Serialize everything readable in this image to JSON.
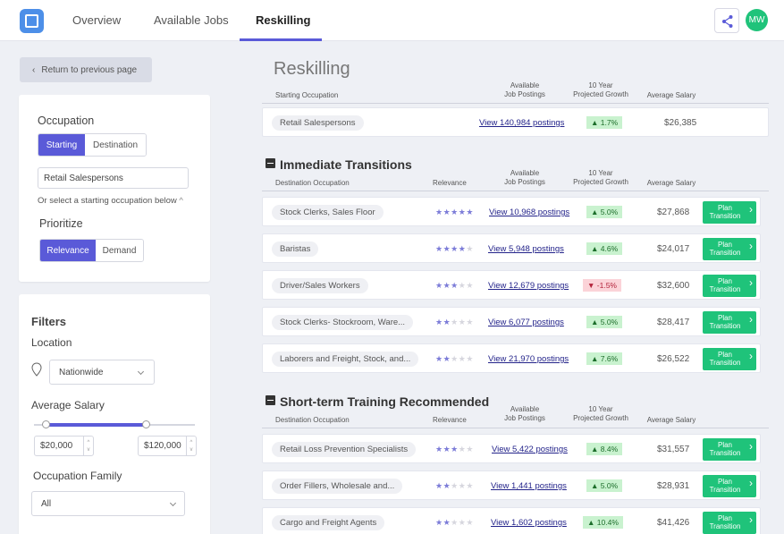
{
  "nav": {
    "tabs": [
      "Overview",
      "Available Jobs",
      "Reskilling"
    ],
    "active_tab": "Reskilling",
    "avatar_initials": "MW",
    "accent_color": "#5a5ad8",
    "logo_color": "#4d8fe8"
  },
  "sidebar": {
    "back_label": "Return to previous page",
    "occupation_label": "Occupation",
    "occupation_toggle": [
      "Starting",
      "Destination"
    ],
    "occupation_selected": "Starting",
    "occupation_value": "Retail Salespersons",
    "select_hint": "Or select a starting occupation below",
    "prioritize_label": "Prioritize",
    "prioritize_toggle": [
      "Relevance",
      "Demand"
    ],
    "prioritize_selected": "Relevance",
    "filters_title": "Filters",
    "location_label": "Location",
    "location_value": "Nationwide",
    "salary_label": "Average Salary",
    "salary_min": "$20,000",
    "salary_max": "$120,000",
    "family_label": "Occupation Family",
    "family_value": "All"
  },
  "main": {
    "title": "Reskilling",
    "starting_header": {
      "occupation": "Starting Occupation",
      "postings": "Available\nJob Postings",
      "growth": "10 Year\nProjected Growth",
      "salary": "Average Salary"
    },
    "starting_row": {
      "name": "Retail Salespersons",
      "postings": "View 140,984 postings",
      "growth": "▲ 1.7%",
      "salary": "$26,385"
    },
    "destination_header": {
      "occupation": "Destination Occupation",
      "relevance": "Relevance",
      "postings": "Available\nJob Postings",
      "growth": "10 Year\nProjected Growth",
      "salary": "Average Salary"
    },
    "plan_label": "Plan\nTransition",
    "sections": [
      {
        "title": "Immediate Transitions",
        "rows": [
          {
            "name": "Stock Clerks, Sales Floor",
            "stars": 5,
            "postings": "View 10,968 postings",
            "growth": "▲ 5.0%",
            "trend": "up",
            "salary": "$27,868"
          },
          {
            "name": "Baristas",
            "stars": 4,
            "postings": "View 5,948 postings",
            "growth": "▲ 4.6%",
            "trend": "up",
            "salary": "$24,017"
          },
          {
            "name": "Driver/Sales Workers",
            "stars": 3,
            "postings": "View 12,679 postings",
            "growth": "▼ -1.5%",
            "trend": "down",
            "salary": "$32,600"
          },
          {
            "name": "Stock Clerks- Stockroom, Ware...",
            "stars": 2,
            "postings": "View 6,077 postings",
            "growth": "▲ 5.0%",
            "trend": "up",
            "salary": "$28,417"
          },
          {
            "name": "Laborers and Freight, Stock, and...",
            "stars": 2,
            "postings": "View 21,970 postings",
            "growth": "▲ 7.6%",
            "trend": "up",
            "salary": "$26,522"
          }
        ]
      },
      {
        "title": "Short-term Training Recommended",
        "rows": [
          {
            "name": "Retail Loss Prevention Specialists",
            "stars": 3,
            "postings": "View 5,422 postings",
            "growth": "▲ 8.4%",
            "trend": "up",
            "salary": "$31,557"
          },
          {
            "name": "Order Fillers, Wholesale and...",
            "stars": 2,
            "postings": "View 1,441 postings",
            "growth": "▲ 5.0%",
            "trend": "up",
            "salary": "$28,931"
          },
          {
            "name": "Cargo and Freight Agents",
            "stars": 2,
            "postings": "View 1,602 postings",
            "growth": "▲ 10.4%",
            "trend": "up",
            "salary": "$41,426"
          }
        ]
      }
    ]
  }
}
